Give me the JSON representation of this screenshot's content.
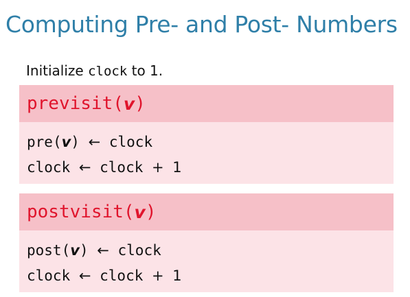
{
  "slide": {
    "title": "Computing Pre- and Post- Numbers",
    "intro": {
      "prefix": "Initialize ",
      "code": "clock",
      "suffix": " to 1."
    }
  },
  "procedures": [
    {
      "name": "previsit",
      "param": "v",
      "lines": [
        {
          "lhs_fn": "pre",
          "lhs_arg": "v",
          "arrow": "←",
          "rhs": "clock"
        },
        {
          "lhs": "clock",
          "arrow": "←",
          "rhs": "clock",
          "op": "+",
          "num": "1"
        }
      ]
    },
    {
      "name": "postvisit",
      "param": "v",
      "lines": [
        {
          "lhs_fn": "post",
          "lhs_arg": "v",
          "arrow": "←",
          "rhs": "clock"
        },
        {
          "lhs": "clock",
          "arrow": "←",
          "rhs": "clock",
          "op": "+",
          "num": "1"
        }
      ]
    }
  ],
  "colors": {
    "title": "#2f7fa8",
    "header_bg": "#f6c0c8",
    "body_bg": "#fce3e7",
    "procedure_name": "#e0142c"
  }
}
